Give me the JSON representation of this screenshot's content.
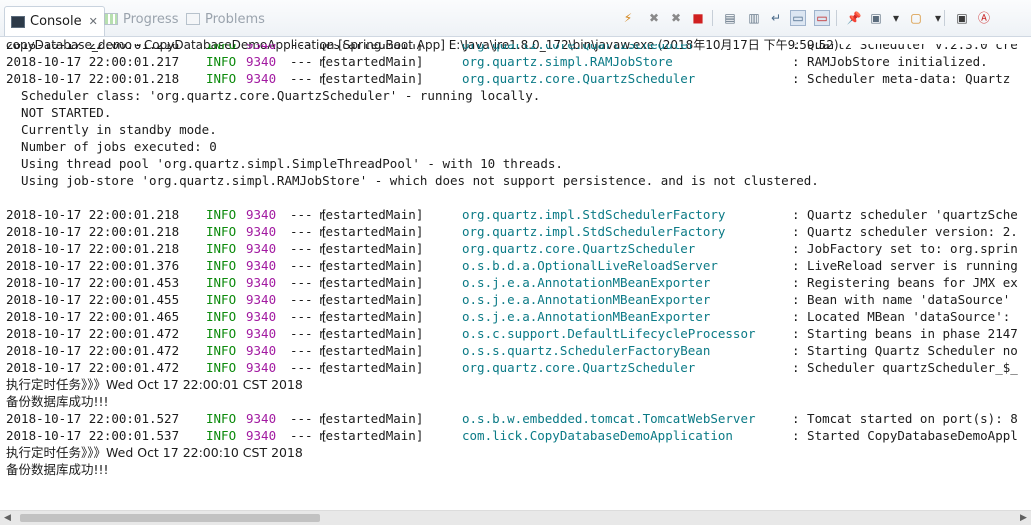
{
  "tabs": [
    {
      "label": "Console",
      "icon": "console-icon",
      "active": true,
      "close": "✕"
    },
    {
      "label": "Progress",
      "icon": "progress-icon",
      "active": false
    },
    {
      "label": "Problems",
      "icon": "problems-icon",
      "active": false
    }
  ],
  "toolbar": [
    {
      "name": "terminate-relaunch-icon",
      "glyph": "⚡",
      "color": "#d4851a"
    },
    {
      "name": "remove-launch-icon",
      "glyph": "✖",
      "color": "#8a8a8a"
    },
    {
      "name": "remove-all-launches-icon",
      "glyph": "✖",
      "color": "#8a8a8a"
    },
    {
      "name": "terminate-icon",
      "glyph": "■",
      "color": "#d02020"
    },
    {
      "name": "clear-console-icon",
      "glyph": "▤",
      "color": "#5a6b7c"
    },
    {
      "name": "scroll-lock-icon",
      "glyph": "▥",
      "color": "#6a7b8c"
    },
    {
      "name": "word-wrap-icon",
      "glyph": "↵",
      "color": "#4a6a8a"
    },
    {
      "name": "show-console-stdout-icon",
      "glyph": "▭",
      "color": "#4a6a8a",
      "toggled": true
    },
    {
      "name": "show-console-stderr-icon",
      "glyph": "▭",
      "color": "#c02020",
      "toggled": true
    },
    {
      "name": "pin-console-icon",
      "glyph": "📌",
      "color": "#2a7a4a"
    },
    {
      "name": "display-selected-console-icon",
      "glyph": "▣",
      "color": "#5a6b7c"
    },
    {
      "name": "display-selected-console-dropdown-icon",
      "glyph": "▾",
      "color": "#333333"
    },
    {
      "name": "open-console-icon",
      "glyph": "▢",
      "color": "#d4851a"
    },
    {
      "name": "open-console-dropdown-icon",
      "glyph": "▾",
      "color": "#333333"
    },
    {
      "name": "minimize-icon",
      "glyph": "▣",
      "color": "#3a3a3a"
    },
    {
      "name": "maximize-icon",
      "glyph": "Ⓐ",
      "color": "#c81e1e"
    }
  ],
  "process_line": "copyDatabase_demo - CopyDatabaseDemoApplication [Spring Boot App] E:\\Java\\jre1.8.0_172\\bin\\javaw.exe (2018年10月17日 下午9:59:52)",
  "log": [
    {
      "ts": "2018-10-17 22:00:01.216",
      "lvl": "INFO",
      "pid": "9340",
      "dash": "--- [",
      "thr": " restartedMain]",
      "cls": "org.quartz.core.QuartzScheduler",
      "msg": ": Quartz Scheduler v.2.3.0 cre"
    },
    {
      "ts": "2018-10-17 22:00:01.217",
      "lvl": "INFO",
      "pid": "9340",
      "dash": "--- [",
      "thr": " restartedMain]",
      "cls": "org.quartz.simpl.RAMJobStore",
      "msg": ": RAMJobStore initialized."
    },
    {
      "ts": "2018-10-17 22:00:01.218",
      "lvl": "INFO",
      "pid": "9340",
      "dash": "--- [",
      "thr": " restartedMain]",
      "cls": "org.quartz.core.QuartzScheduler",
      "msg": ": Scheduler meta-data: Quartz"
    },
    {
      "plain": "  Scheduler class: 'org.quartz.core.QuartzScheduler' - running locally."
    },
    {
      "plain": "  NOT STARTED."
    },
    {
      "plain": "  Currently in standby mode."
    },
    {
      "plain": "  Number of jobs executed: 0"
    },
    {
      "plain": "  Using thread pool 'org.quartz.simpl.SimpleThreadPool' - with 10 threads."
    },
    {
      "plain": "  Using job-store 'org.quartz.simpl.RAMJobStore' - which does not support persistence. and is not clustered."
    },
    {
      "plain": ""
    },
    {
      "ts": "2018-10-17 22:00:01.218",
      "lvl": "INFO",
      "pid": "9340",
      "dash": "--- [",
      "thr": " restartedMain]",
      "cls": "org.quartz.impl.StdSchedulerFactory",
      "msg": ": Quartz scheduler 'quartzSche"
    },
    {
      "ts": "2018-10-17 22:00:01.218",
      "lvl": "INFO",
      "pid": "9340",
      "dash": "--- [",
      "thr": " restartedMain]",
      "cls": "org.quartz.impl.StdSchedulerFactory",
      "msg": ": Quartz scheduler version: 2."
    },
    {
      "ts": "2018-10-17 22:00:01.218",
      "lvl": "INFO",
      "pid": "9340",
      "dash": "--- [",
      "thr": " restartedMain]",
      "cls": "org.quartz.core.QuartzScheduler",
      "msg": ": JobFactory set to: org.sprin"
    },
    {
      "ts": "2018-10-17 22:00:01.376",
      "lvl": "INFO",
      "pid": "9340",
      "dash": "--- [",
      "thr": " restartedMain]",
      "cls": "o.s.b.d.a.OptionalLiveReloadServer",
      "msg": ": LiveReload server is running"
    },
    {
      "ts": "2018-10-17 22:00:01.453",
      "lvl": "INFO",
      "pid": "9340",
      "dash": "--- [",
      "thr": " restartedMain]",
      "cls": "o.s.j.e.a.AnnotationMBeanExporter",
      "msg": ": Registering beans for JMX ex"
    },
    {
      "ts": "2018-10-17 22:00:01.455",
      "lvl": "INFO",
      "pid": "9340",
      "dash": "--- [",
      "thr": " restartedMain]",
      "cls": "o.s.j.e.a.AnnotationMBeanExporter",
      "msg": ": Bean with name 'dataSource'"
    },
    {
      "ts": "2018-10-17 22:00:01.465",
      "lvl": "INFO",
      "pid": "9340",
      "dash": "--- [",
      "thr": " restartedMain]",
      "cls": "o.s.j.e.a.AnnotationMBeanExporter",
      "msg": ": Located MBean 'dataSource':"
    },
    {
      "ts": "2018-10-17 22:00:01.472",
      "lvl": "INFO",
      "pid": "9340",
      "dash": "--- [",
      "thr": " restartedMain]",
      "cls": "o.s.c.support.DefaultLifecycleProcessor",
      "msg": ": Starting beans in phase 2147"
    },
    {
      "ts": "2018-10-17 22:00:01.472",
      "lvl": "INFO",
      "pid": "9340",
      "dash": "--- [",
      "thr": " restartedMain]",
      "cls": "o.s.s.quartz.SchedulerFactoryBean",
      "msg": ": Starting Quartz Scheduler no"
    },
    {
      "ts": "2018-10-17 22:00:01.472",
      "lvl": "INFO",
      "pid": "9340",
      "dash": "--- [",
      "thr": " restartedMain]",
      "cls": "org.quartz.core.QuartzScheduler",
      "msg": ": Scheduler quartzScheduler_$_"
    },
    {
      "cn": "执行定时任务》》》Wed Oct 17 22:00:01 CST 2018"
    },
    {
      "cn": "备份数据库成功!!!"
    },
    {
      "ts": "2018-10-17 22:00:01.527",
      "lvl": "INFO",
      "pid": "9340",
      "dash": "--- [",
      "thr": " restartedMain]",
      "cls": "o.s.b.w.embedded.tomcat.TomcatWebServer",
      "msg": ": Tomcat started on port(s): 8"
    },
    {
      "ts": "2018-10-17 22:00:01.537",
      "lvl": "INFO",
      "pid": "9340",
      "dash": "--- [",
      "thr": " restartedMain]",
      "cls": "com.lick.CopyDatabaseDemoApplication",
      "msg": ": Started CopyDatabaseDemoAppl"
    },
    {
      "cn": "执行定时任务》》》Wed Oct 17 22:00:10 CST 2018"
    },
    {
      "cn": "备份数据库成功!!!"
    }
  ],
  "scrollbar": {
    "left": "◀",
    "right": "▶"
  }
}
